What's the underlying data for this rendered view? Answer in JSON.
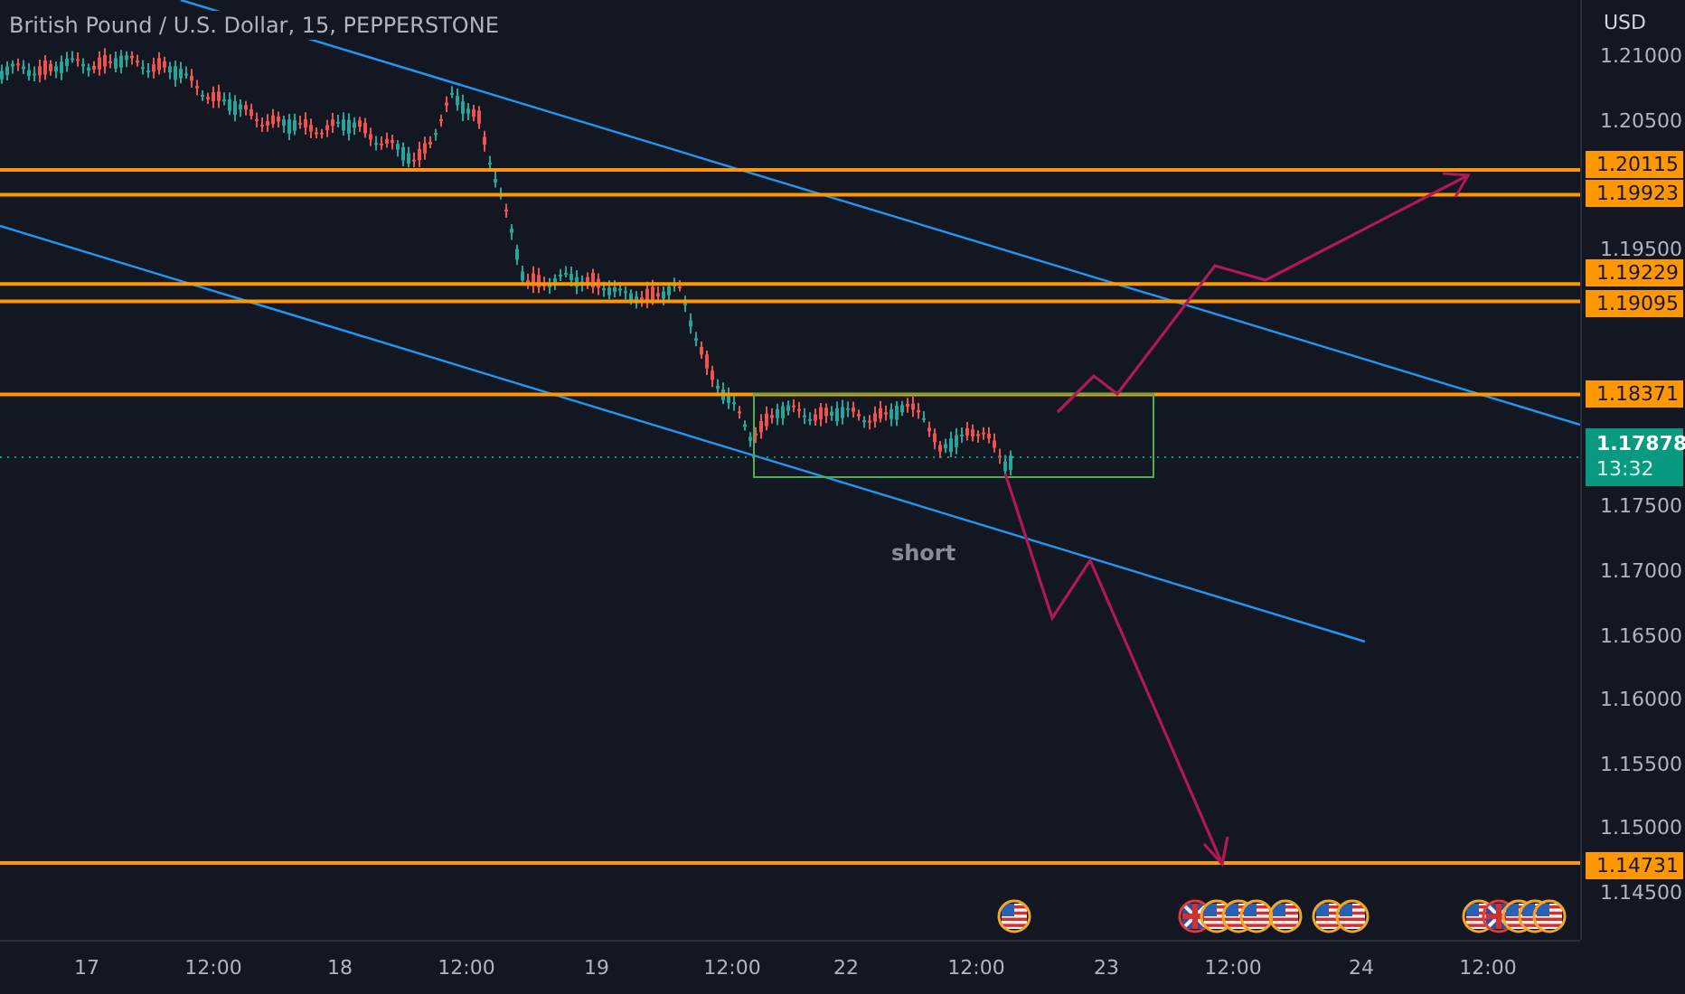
{
  "title": "British Pound / U.S. Dollar, 15, PEPPERSTONE",
  "price_axis": {
    "currency": "USD",
    "labels": [
      "1.21000",
      "1.20500",
      "1.19500",
      "1.17500",
      "1.17000",
      "1.16500",
      "1.16000",
      "1.15500",
      "1.15000",
      "1.14500"
    ]
  },
  "levels": [
    {
      "price": "1.20115"
    },
    {
      "price": "1.19923"
    },
    {
      "price": "1.19229"
    },
    {
      "price": "1.19095"
    },
    {
      "price": "1.18371"
    },
    {
      "price": "1.14731"
    }
  ],
  "current_price": {
    "price": "1.17878",
    "countdown": "13:32"
  },
  "annotation": "short",
  "events": [
    {
      "kind": "us"
    },
    {
      "kind": "uk"
    },
    {
      "kind": "us"
    },
    {
      "kind": "us"
    },
    {
      "kind": "us"
    },
    {
      "kind": "us"
    },
    {
      "kind": "us"
    },
    {
      "kind": "us"
    },
    {
      "kind": "us"
    },
    {
      "kind": "uk"
    },
    {
      "kind": "us"
    },
    {
      "kind": "us"
    },
    {
      "kind": "us"
    }
  ],
  "time_axis": [
    "17",
    "12:00",
    "18",
    "12:00",
    "19",
    "12:00",
    "22",
    "12:00",
    "23",
    "12:00",
    "24",
    "12:00"
  ]
}
